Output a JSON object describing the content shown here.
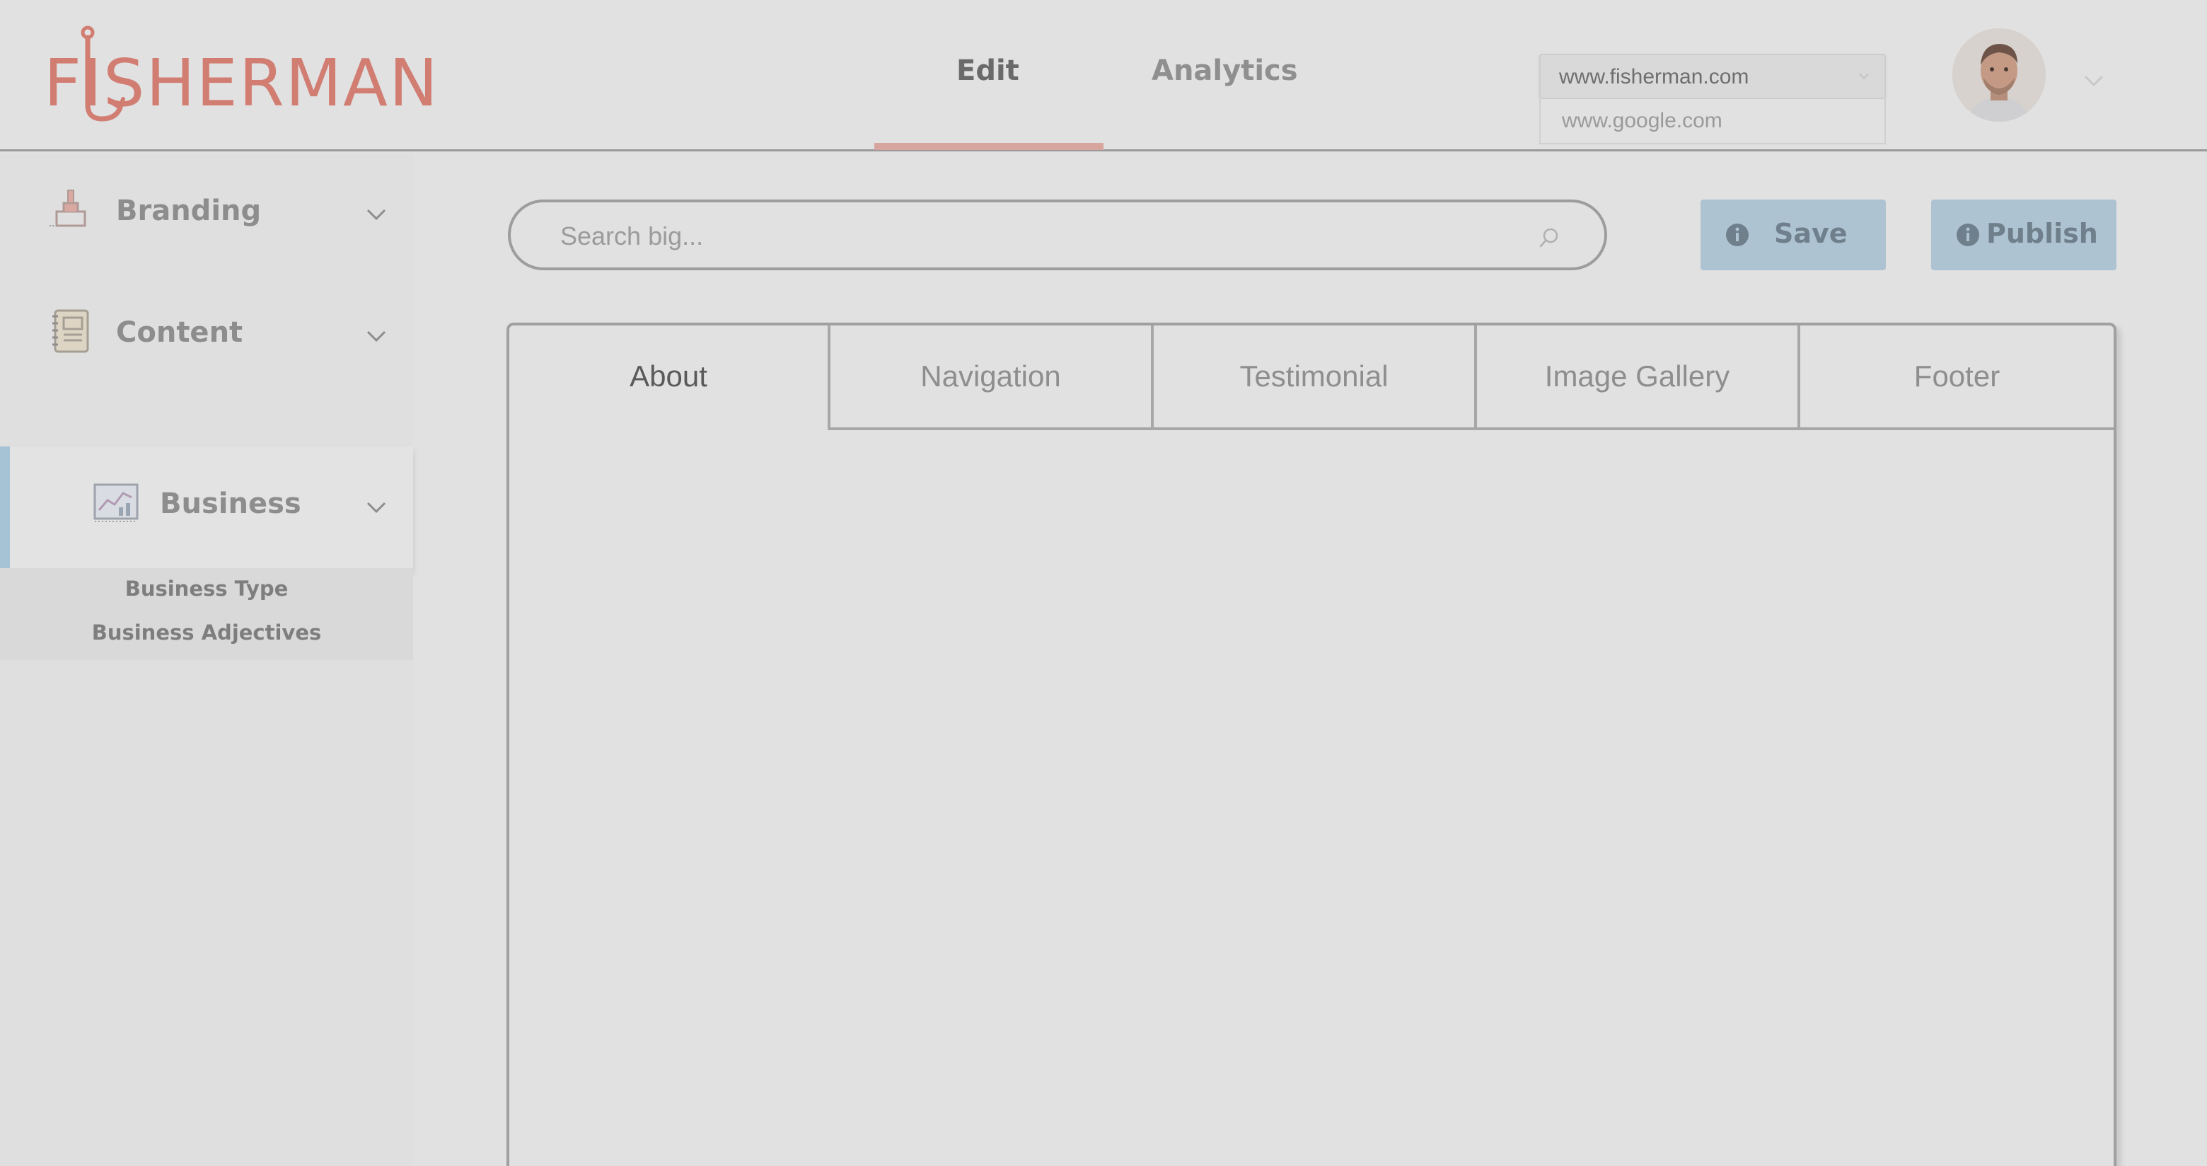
{
  "header": {
    "logo_text": "FISHERMAN",
    "nav": {
      "edit": "Edit",
      "analytics": "Analytics"
    },
    "site_select": {
      "selected": "www.fisherman.com",
      "options": [
        "www.fisherman.com",
        "www.google.com"
      ]
    },
    "alt_option": "www.google.com"
  },
  "sidebar": {
    "items": [
      {
        "label": "Branding",
        "icon": "paint-brush-icon"
      },
      {
        "label": "Content",
        "icon": "notebook-icon"
      },
      {
        "label": "Business",
        "icon": "chart-icon"
      }
    ],
    "business_submenu": [
      "Business Type",
      "Business Adjectives"
    ]
  },
  "search": {
    "placeholder": "Search big..."
  },
  "actions": {
    "save": "Save",
    "publish": "Publish"
  },
  "tabs": [
    "About",
    "Navigation",
    "Testimonial",
    "Image Gallery",
    "Footer"
  ],
  "active_tab": "About",
  "colors": {
    "brand": "#d17d72",
    "accent_button": "#aec3d1",
    "active_indicator": "#a6c3d6",
    "background": "#e1e1e1"
  }
}
